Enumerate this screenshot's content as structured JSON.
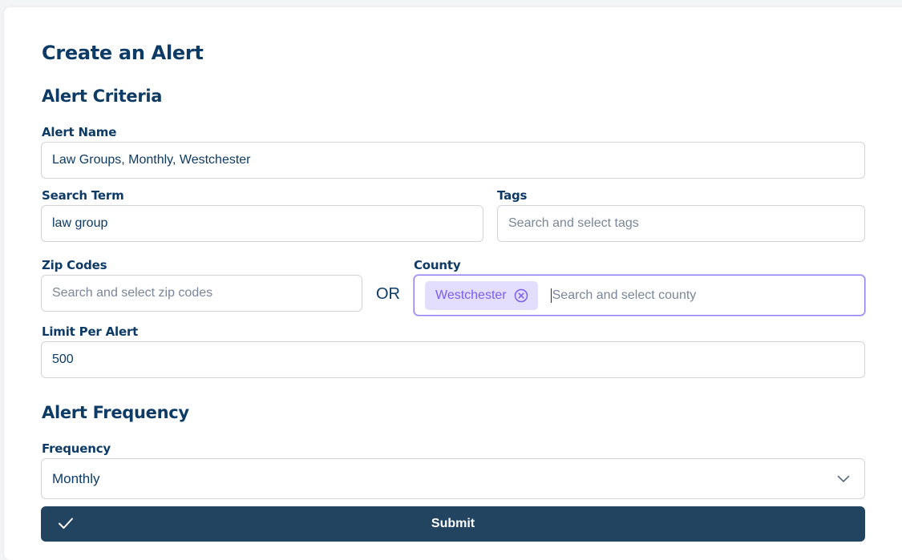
{
  "form": {
    "title": "Create an Alert",
    "criteria": {
      "heading": "Alert Criteria",
      "alert_name": {
        "label": "Alert Name",
        "value": "Law Groups, Monthly, Westchester",
        "placeholder": ""
      },
      "search_term": {
        "label": "Search Term",
        "value": "law group",
        "placeholder": ""
      },
      "tags": {
        "label": "Tags",
        "value": "",
        "placeholder": "Search and select tags"
      },
      "zip_codes": {
        "label": "Zip Codes",
        "value": "",
        "placeholder": "Search and select zip codes"
      },
      "or_text": "OR",
      "county": {
        "label": "County",
        "selected": [
          "Westchester"
        ],
        "value": "",
        "placeholder": "Search and select county"
      },
      "limit": {
        "label": "Limit Per Alert",
        "value": "500",
        "placeholder": ""
      }
    },
    "frequency": {
      "heading": "Alert Frequency",
      "label": "Frequency",
      "selected": "Monthly"
    },
    "submit_label": "Submit"
  },
  "icons": {
    "chip_remove": "circle-x-icon",
    "dropdown": "chevron-down-icon",
    "submit": "check-icon"
  },
  "colors": {
    "heading": "#0d3b66",
    "submit_bg": "#224461",
    "chip_bg": "#e3defd",
    "chip_text": "#7a5ef0",
    "focus_border": "#8b7cf0"
  }
}
